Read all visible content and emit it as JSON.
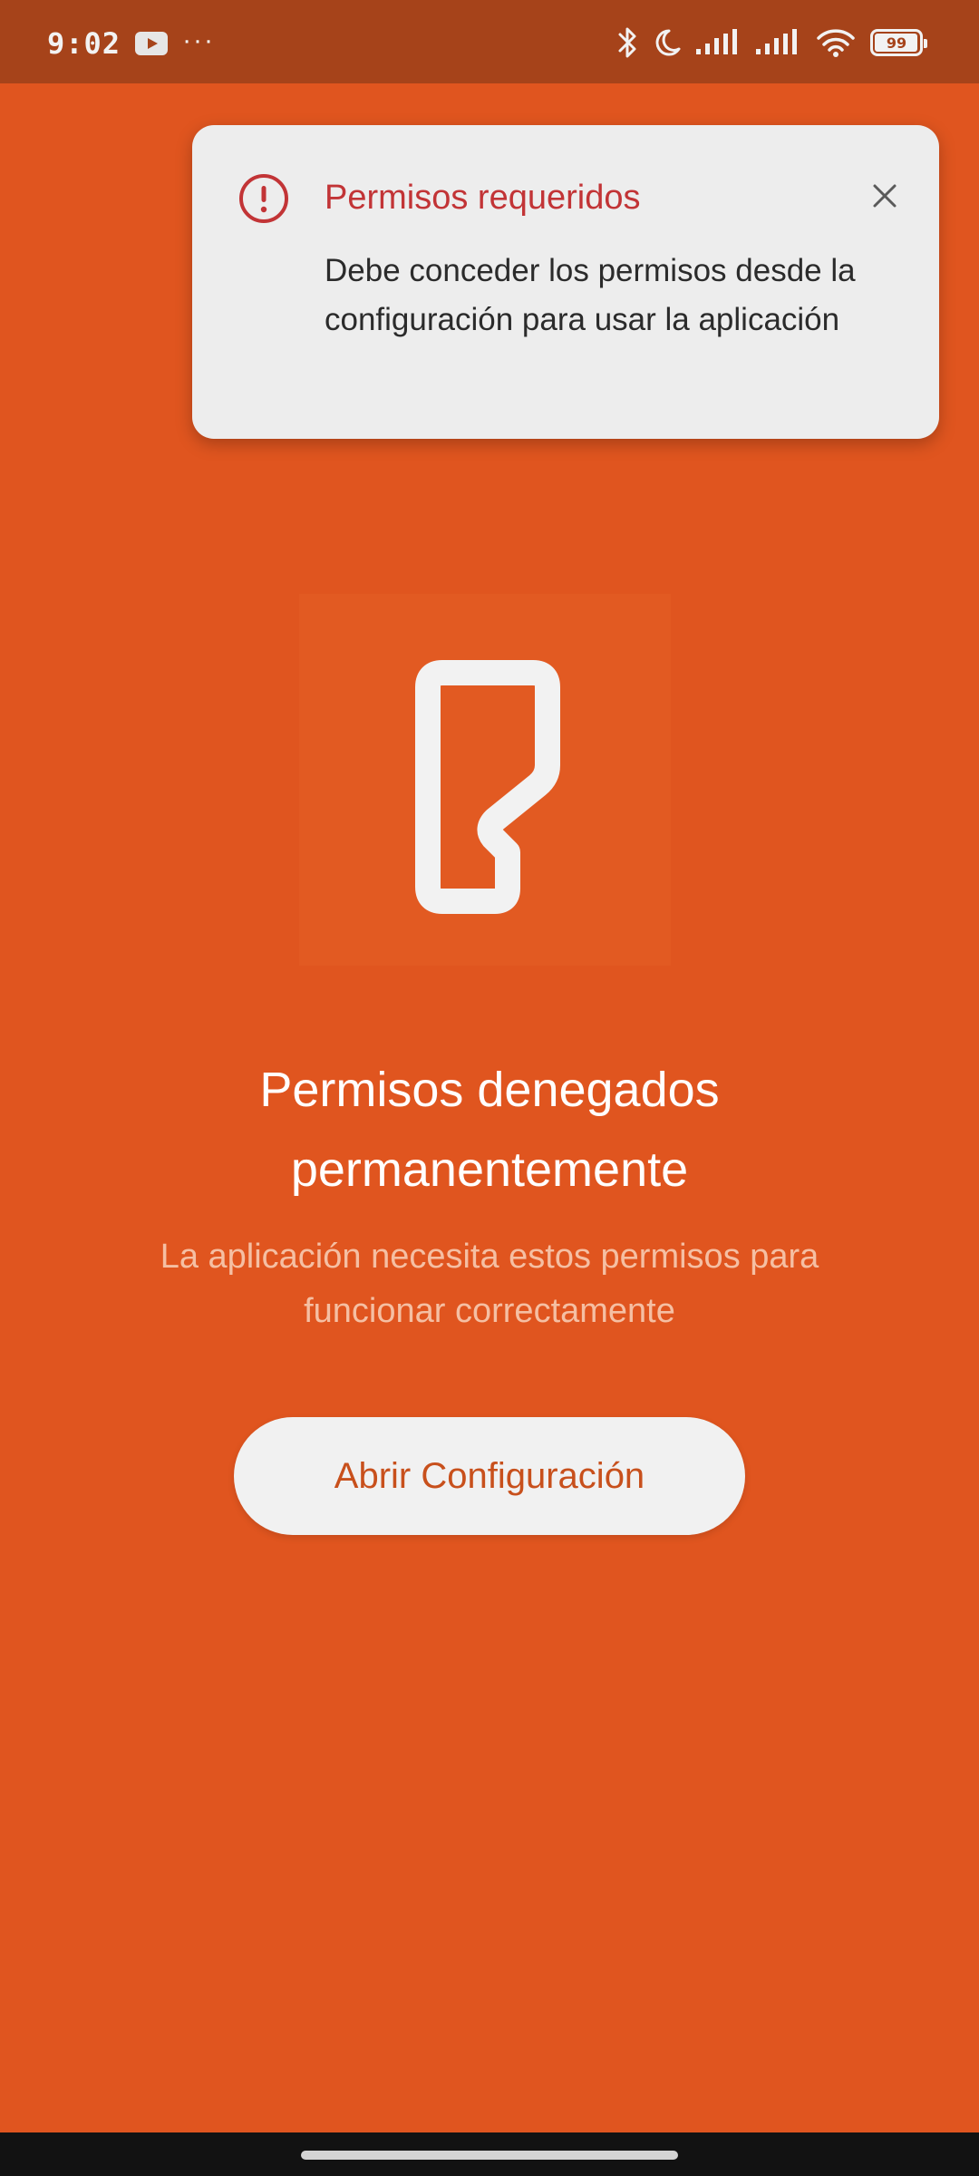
{
  "status_bar": {
    "time": "9:02",
    "notification_icons": [
      "youtube-icon"
    ],
    "more_indicator": "···",
    "icons": [
      "bluetooth-icon",
      "moon-icon",
      "signal-icon",
      "signal-icon",
      "wifi-icon",
      "battery-icon"
    ],
    "battery_percent": 99,
    "battery_label": "99"
  },
  "toast": {
    "icon": "alert-circle-icon",
    "title": "Permisos requeridos",
    "message": "Debe conceder los permisos desde la configuración para usar la aplicación",
    "close_icon": "close-icon",
    "accent_color": "#C23436"
  },
  "logo": {
    "icon": "app-logo-icon"
  },
  "main": {
    "heading_line1": "Permisos denegados",
    "heading_line2": "permanentemente",
    "subtext_line1": "La aplicación necesita estos permisos para",
    "subtext_line2": "funcionar correctamente",
    "button_label": "Abrir Configuración"
  },
  "colors": {
    "background": "#E0551F",
    "status_bar": "#A6431A",
    "toast_background": "#EDEDED",
    "button_background": "#F1F1F1",
    "button_text": "#C8501C"
  }
}
